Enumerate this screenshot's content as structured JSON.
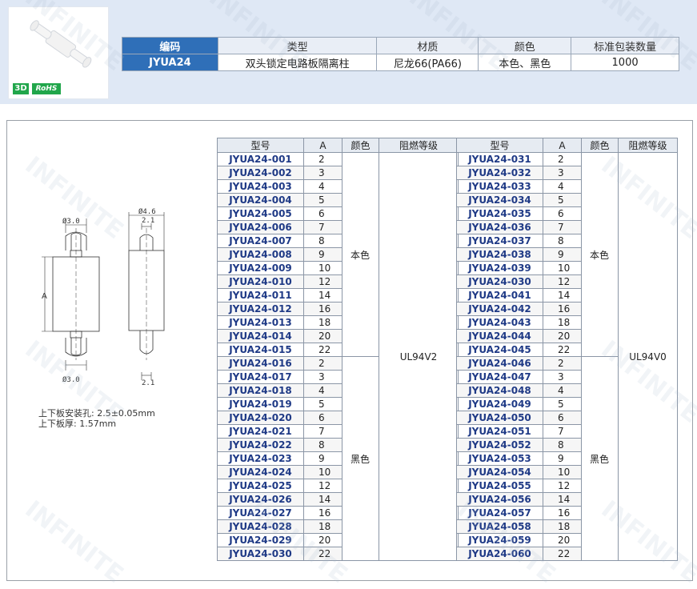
{
  "badges": {
    "three_d": "3D",
    "rohs": "RoHS"
  },
  "info_table": {
    "headers": [
      "编码",
      "类型",
      "材质",
      "颜色",
      "标准包装数量"
    ],
    "row": [
      "JYUA24",
      "双头锁定电路板隔离柱",
      "尼龙66(PA66)",
      "本色、黑色",
      "1000"
    ]
  },
  "drawing": {
    "dim_d30_top": "Ø3.0",
    "dim_d30_bottom": "Ø3.0",
    "dim_d46": "Ø4.6",
    "dim_21_top": "2.1",
    "dim_21_bottom": "2.1",
    "dim_a": "A"
  },
  "notes": [
    "上下板安装孔: 2.5±0.05mm",
    "上下板厚: 1.57mm"
  ],
  "spec_headers": [
    "型号",
    "A",
    "颜色",
    "阻燃等级"
  ],
  "spec_left": {
    "models": [
      "JYUA24-001",
      "JYUA24-002",
      "JYUA24-003",
      "JYUA24-004",
      "JYUA24-005",
      "JYUA24-006",
      "JYUA24-007",
      "JYUA24-008",
      "JYUA24-009",
      "JYUA24-010",
      "JYUA24-011",
      "JYUA24-012",
      "JYUA24-013",
      "JYUA24-014",
      "JYUA24-015",
      "JYUA24-016",
      "JYUA24-017",
      "JYUA24-018",
      "JYUA24-019",
      "JYUA24-020",
      "JYUA24-021",
      "JYUA24-022",
      "JYUA24-023",
      "JYUA24-024",
      "JYUA24-025",
      "JYUA24-026",
      "JYUA24-027",
      "JYUA24-028",
      "JYUA24-029",
      "JYUA24-030"
    ],
    "a": [
      "2",
      "3",
      "4",
      "5",
      "6",
      "7",
      "8",
      "9",
      "10",
      "12",
      "14",
      "16",
      "18",
      "20",
      "22",
      "2",
      "3",
      "4",
      "5",
      "6",
      "7",
      "8",
      "9",
      "10",
      "12",
      "14",
      "16",
      "18",
      "20",
      "22"
    ],
    "color_1": "本色",
    "color_2": "黑色",
    "grade": "UL94V2"
  },
  "spec_right": {
    "models": [
      "JYUA24-031",
      "JYUA24-032",
      "JYUA24-033",
      "JYUA24-034",
      "JYUA24-035",
      "JYUA24-036",
      "JYUA24-037",
      "JYUA24-038",
      "JYUA24-039",
      "JYUA24-030",
      "JYUA24-041",
      "JYUA24-042",
      "JYUA24-043",
      "JYUA24-044",
      "JYUA24-045",
      "JYUA24-046",
      "JYUA24-047",
      "JYUA24-048",
      "JYUA24-049",
      "JYUA24-050",
      "JYUA24-051",
      "JYUA24-052",
      "JYUA24-053",
      "JYUA24-054",
      "JYUA24-055",
      "JYUA24-056",
      "JYUA24-057",
      "JYUA24-058",
      "JYUA24-059",
      "JYUA24-060"
    ],
    "a": [
      "2",
      "3",
      "4",
      "5",
      "6",
      "7",
      "8",
      "9",
      "10",
      "12",
      "14",
      "16",
      "18",
      "20",
      "22",
      "2",
      "3",
      "4",
      "5",
      "6",
      "7",
      "8",
      "9",
      "10",
      "12",
      "14",
      "16",
      "18",
      "20",
      "22"
    ],
    "color_1": "本色",
    "color_2": "黑色",
    "grade": "UL94V0"
  },
  "watermark": "INFINITE"
}
